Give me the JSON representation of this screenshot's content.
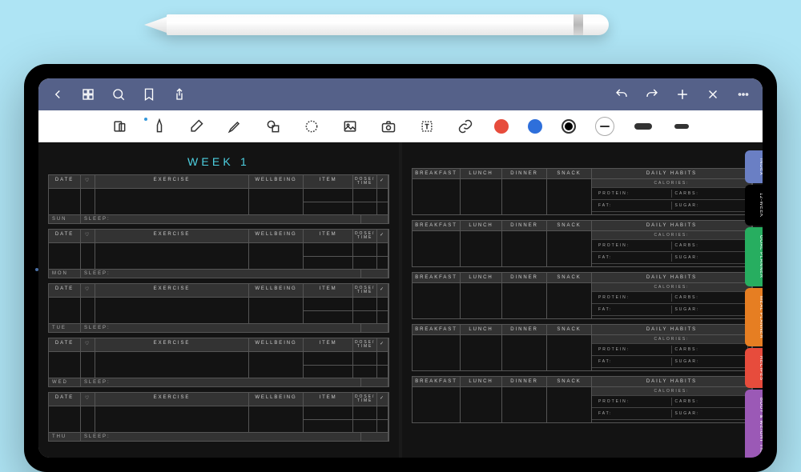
{
  "title": "WEEK 1",
  "left_headers": {
    "date": "DATE",
    "exercise": "EXERCISE",
    "wellbeing": "WELLBEING",
    "item": "ITEM",
    "dose_time": "DOSE/\nTIME",
    "sleep": "SLEEP:"
  },
  "days": [
    "SUN",
    "MON",
    "TUE",
    "WED",
    "THU"
  ],
  "right_headers": {
    "breakfast": "BREAKFAST",
    "lunch": "LUNCH",
    "dinner": "DINNER",
    "snack": "SNACK",
    "habits": "DAILY HABITS"
  },
  "habit_rows": {
    "calories": "CALORIES:",
    "protein": "PROTEIN:",
    "carbs": "CARBS:",
    "fat": "FAT:",
    "sugar": "SUGAR:"
  },
  "tabs": [
    "INDEX",
    "12-WEEK",
    "GOAL PLANNER",
    "MEAL PLANNER",
    "RECIPES",
    "BODY & WEIGHT TRACKER"
  ],
  "colors": {
    "red": "#e74c3c",
    "blue": "#2e6fdb",
    "black": "#000"
  }
}
